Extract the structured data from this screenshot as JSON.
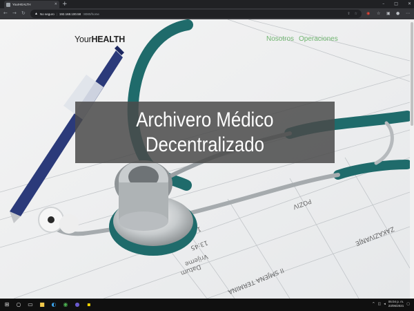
{
  "browser": {
    "tab_title": "YourHEALTH",
    "new_tab_symbol": "+",
    "security_label": "No seguro",
    "url_host": "192.168.100.58",
    "url_path": ":8080/home",
    "icons": [
      "back-icon",
      "forward-icon",
      "reload-icon",
      "warning-icon",
      "share-icon",
      "star-icon",
      "extension-icon",
      "collections-icon",
      "profile-icon",
      "menu-icon"
    ]
  },
  "page": {
    "brand_regular": "Your",
    "brand_bold": "HEALTH",
    "nav": [
      {
        "label": "Nosotros"
      },
      {
        "label": "Operaciones"
      }
    ],
    "headline_line1": "Archivero Médico",
    "headline_line2": "Decentralizado",
    "colors": {
      "nav_link": "#6fb46f",
      "headline_box": "#4a4a4a",
      "headline_text": "#ffffff",
      "stethoscope": "#1f6b6b"
    }
  },
  "taskbar": {
    "time": "05:04 p. m.",
    "date": "23/06/2021",
    "icons": [
      "windows-start-icon",
      "search-icon",
      "task-view-icon",
      "file-explorer-icon",
      "edge-icon",
      "chrome-icon",
      "app-icon",
      "sticky-notes-icon"
    ]
  }
}
